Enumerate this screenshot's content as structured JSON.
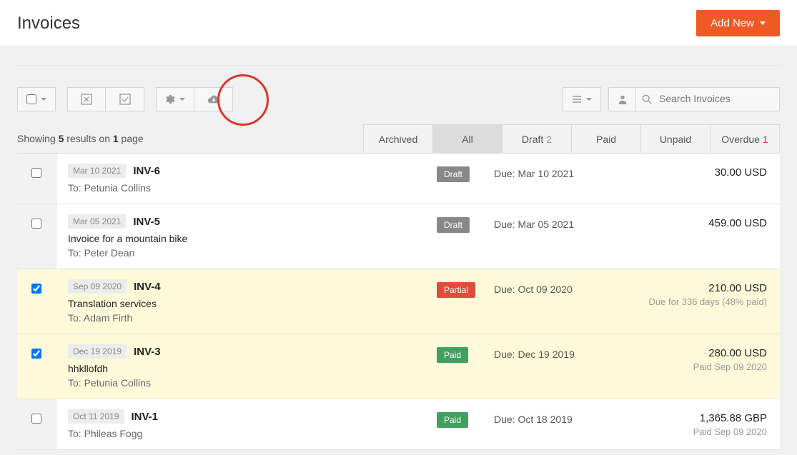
{
  "header": {
    "title": "Invoices",
    "add_button": "Add New"
  },
  "search": {
    "placeholder": "Search Invoices"
  },
  "results": {
    "prefix": "Showing ",
    "count": "5",
    "mid": " results on ",
    "pages": "1",
    "suffix": " page"
  },
  "tabs": [
    {
      "label": "Archived",
      "count": "",
      "active": false,
      "count_class": ""
    },
    {
      "label": "All",
      "count": "",
      "active": true,
      "count_class": ""
    },
    {
      "label": "Draft",
      "count": "2",
      "active": false,
      "count_class": ""
    },
    {
      "label": "Paid",
      "count": "",
      "active": false,
      "count_class": ""
    },
    {
      "label": "Unpaid",
      "count": "",
      "active": false,
      "count_class": ""
    },
    {
      "label": "Overdue",
      "count": "1",
      "active": false,
      "count_class": "red"
    }
  ],
  "rows": [
    {
      "selected": false,
      "date": "Mar 10 2021",
      "id": "INV-6",
      "subject": "",
      "to_prefix": "To: ",
      "to": "Petunia Collins",
      "status_label": "Draft",
      "status_class": "draft",
      "due_prefix": "Due: ",
      "due": "Mar 10 2021",
      "amount": "30.00 USD",
      "amount_sub": ""
    },
    {
      "selected": false,
      "date": "Mar 05 2021",
      "id": "INV-5",
      "subject": "Invoice for a mountain bike",
      "to_prefix": "To: ",
      "to": "Peter Dean",
      "status_label": "Draft",
      "status_class": "draft",
      "due_prefix": "Due: ",
      "due": "Mar 05 2021",
      "amount": "459.00 USD",
      "amount_sub": ""
    },
    {
      "selected": true,
      "date": "Sep 09 2020",
      "id": "INV-4",
      "subject": "Translation services",
      "to_prefix": "To: ",
      "to": "Adam Firth",
      "status_label": "Partial",
      "status_class": "partial",
      "due_prefix": "Due: ",
      "due": "Oct 09 2020",
      "amount": "210.00 USD",
      "amount_sub": "Due for 336 days (48% paid)"
    },
    {
      "selected": true,
      "date": "Dec 19 2019",
      "id": "INV-3",
      "subject": "hhkllofdh",
      "to_prefix": "To: ",
      "to": "Petunia Collins",
      "status_label": "Paid",
      "status_class": "paid",
      "due_prefix": "Due: ",
      "due": "Dec 19 2019",
      "amount": "280.00 USD",
      "amount_sub": "Paid Sep 09 2020"
    },
    {
      "selected": false,
      "date": "Oct 11 2019",
      "id": "INV-1",
      "subject": "",
      "to_prefix": "To: ",
      "to": "Phileas Fogg",
      "status_label": "Paid",
      "status_class": "paid",
      "due_prefix": "Due: ",
      "due": "Oct 18 2019",
      "amount": "1,365.88 GBP",
      "amount_sub": "Paid Sep 09 2020"
    }
  ]
}
